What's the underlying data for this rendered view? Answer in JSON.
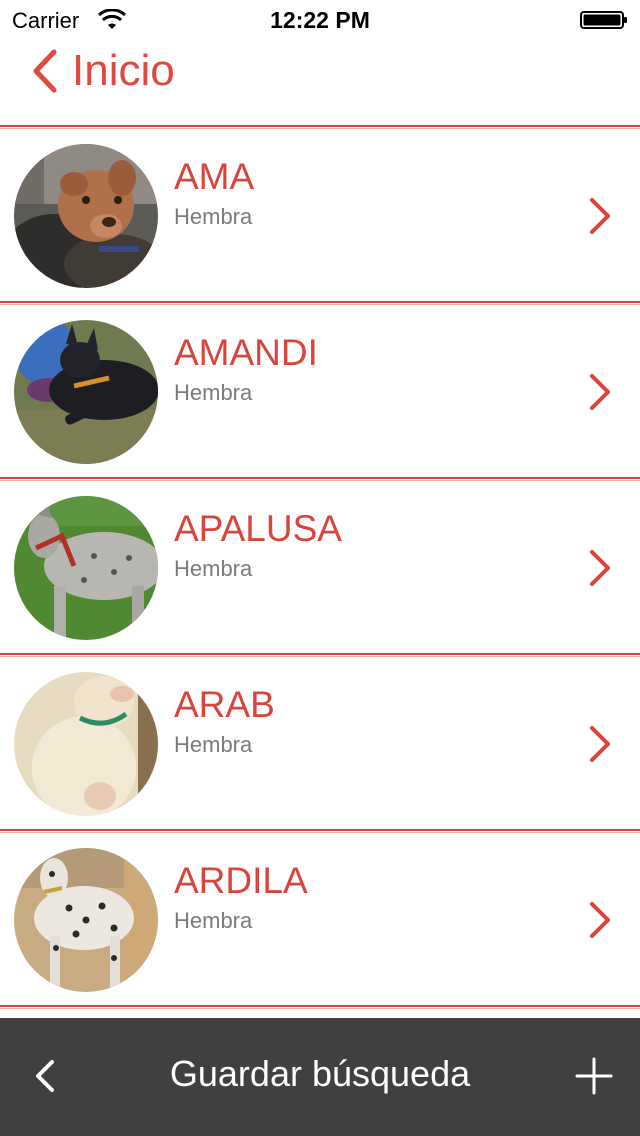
{
  "status_bar": {
    "carrier": "Carrier",
    "time": "12:22 PM",
    "wifi_icon": "wifi-icon",
    "battery_icon": "battery-full-icon"
  },
  "nav": {
    "back_label": "Inicio",
    "back_icon": "chevron-left-icon",
    "accent_color": "#e0493f"
  },
  "items": [
    {
      "name": "AMA",
      "sex": "Hembra",
      "photo": "dog-photo-ama"
    },
    {
      "name": "AMANDI",
      "sex": "Hembra",
      "photo": "dog-photo-amandi"
    },
    {
      "name": "APALUSA",
      "sex": "Hembra",
      "photo": "dog-photo-apalusa"
    },
    {
      "name": "ARAB",
      "sex": "Hembra",
      "photo": "dog-photo-arab"
    },
    {
      "name": "ARDILA",
      "sex": "Hembra",
      "photo": "dog-photo-ardila"
    }
  ],
  "toolbar": {
    "title": "Guardar búsqueda",
    "back_icon": "chevron-left-icon",
    "add_icon": "plus-icon",
    "background_color": "#404040"
  }
}
